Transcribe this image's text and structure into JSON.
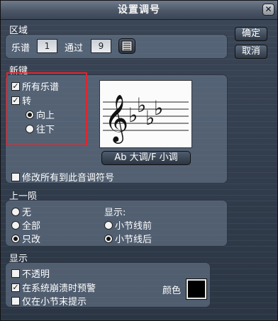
{
  "title": "设置调号",
  "close_icon": "close-icon",
  "buttons": {
    "ok": "确定",
    "cancel": "取消"
  },
  "region": {
    "label": "区域",
    "staff_label": "乐谱",
    "staff_value": "1",
    "through_label": "通过",
    "through_value": "9",
    "picker_icon": "list-picker-icon"
  },
  "new_key": {
    "label": "新键",
    "all_staves": {
      "label": "所有乐谱",
      "checked": true
    },
    "transpose": {
      "label": "转",
      "checked": true
    },
    "up": {
      "label": "向上",
      "selected": true
    },
    "down": {
      "label": "往下",
      "selected": false
    },
    "key_name": "Ab 大调/F 小调",
    "accidental_count": 4,
    "accidental_type": "flat",
    "modify_all": {
      "label": "修改所有到此音调符号",
      "checked": false
    }
  },
  "previous_measure": {
    "label": "上一陨",
    "options": [
      {
        "label": "无",
        "selected": false
      },
      {
        "label": "全部",
        "selected": false
      },
      {
        "label": "只改",
        "selected": true
      }
    ],
    "display_label": "显示:",
    "display_options": [
      {
        "label": "小节线前",
        "selected": false
      },
      {
        "label": "小节线后",
        "selected": true
      }
    ]
  },
  "display": {
    "label": "显示",
    "opaque": {
      "label": "不透明",
      "checked": false
    },
    "warn_system_break": {
      "label": "在系统崩溃时预警",
      "checked": true
    },
    "only_end_measure": {
      "label": "仅在小节末提示",
      "checked": false
    },
    "color_label": "颜色",
    "color_value": "#000000"
  }
}
